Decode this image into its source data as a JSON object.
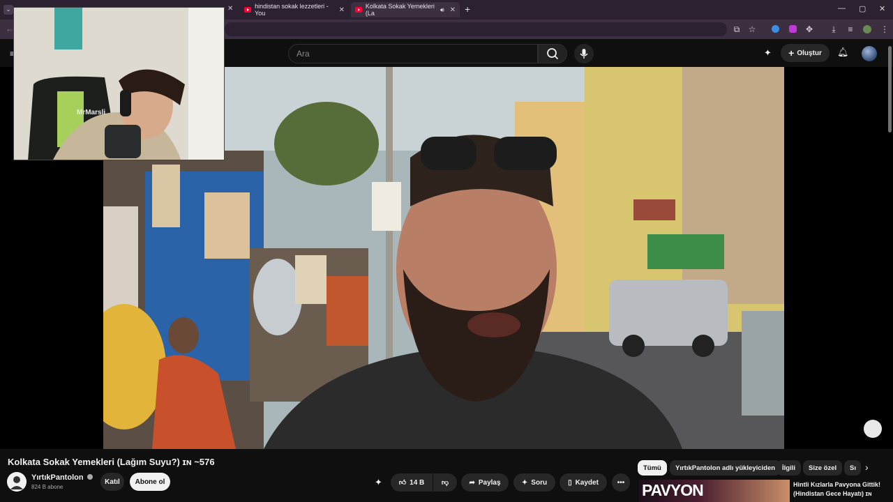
{
  "browser": {
    "tabs": [
      {
        "label": "hindistan sokak lezzetleri - You",
        "active": false
      },
      {
        "label": "Kolkata Sokak Yemekleri (La",
        "active": true
      }
    ],
    "new_tab_icon": "plus-icon"
  },
  "youtube": {
    "search_placeholder": "Ara",
    "create_label": "Oluştur"
  },
  "video": {
    "title": "Kolkata Sokak Yemekleri (Lağım Suyu?) ɪɴ ~576",
    "channel": {
      "name": "YırtıkPantolon",
      "subscribers": "824 B abone",
      "verified": true
    },
    "join_label": "Katıl",
    "subscribe_label": "Abone ol",
    "like_count": "14 B",
    "share_label": "Paylaş",
    "ask_label": "Soru",
    "save_label": "Kaydet"
  },
  "chips": [
    "Tümü",
    "YırtıkPantolon adlı yükleyiciden",
    "İlgili",
    "Size özel",
    "Sı"
  ],
  "recommendation": {
    "thumb_text": "PAVYON",
    "title": "Hintli Kızlarla Pavyona Gittik! (Hindistan Gece Hayatı) ɪɴ"
  },
  "webcam_overlay": {
    "chair_brand": "MrMarsli"
  },
  "colors": {
    "tabstrip": "#2b2130",
    "toolbar": "#3b2f40",
    "youtube_bg": "#0f0f0f",
    "youtube_red": "#ff0033"
  }
}
